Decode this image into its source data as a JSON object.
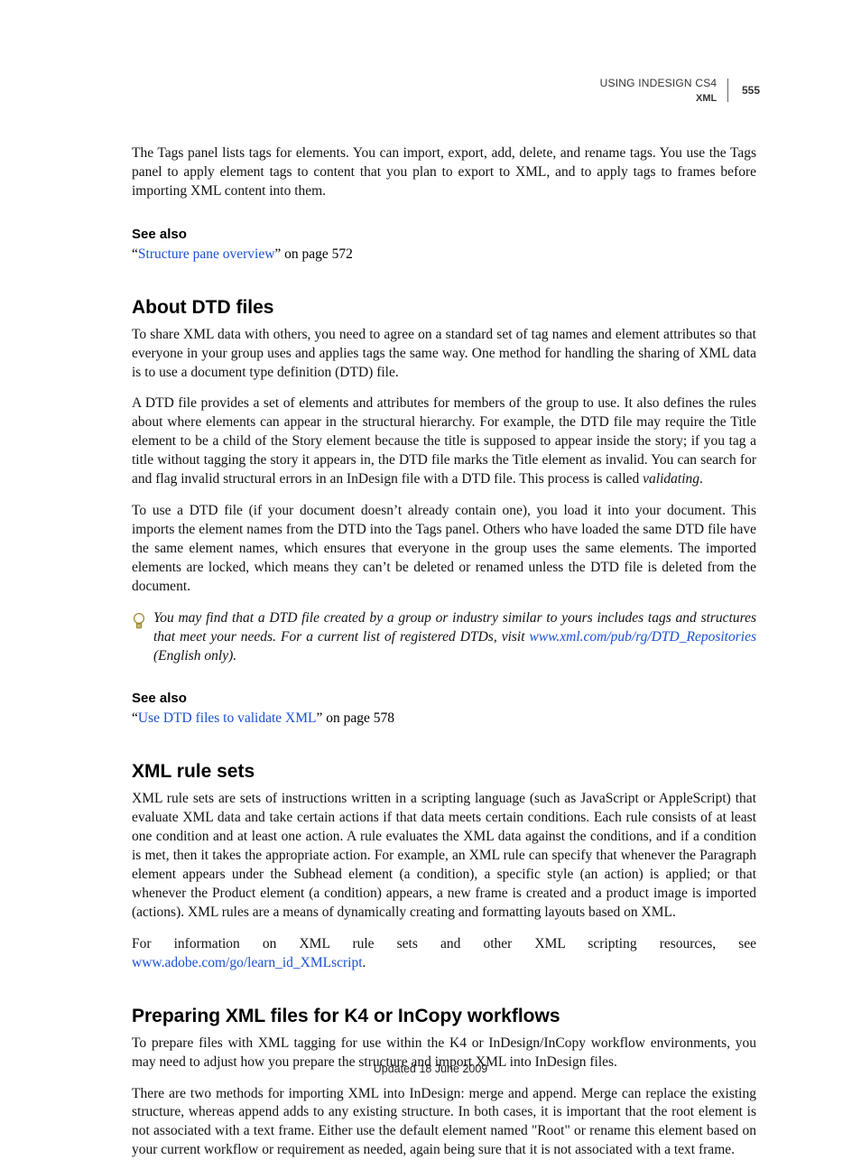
{
  "header": {
    "doc_title": "USING INDESIGN CS4",
    "section": "XML",
    "page_number": "555"
  },
  "intro_paragraph": "The Tags panel lists tags for elements. You can import, export, add, delete, and rename tags. You use the Tags panel to apply element tags to content that you plan to export to XML, and to apply tags to frames before importing XML content into them.",
  "see_also_label": "See also",
  "xref1": {
    "open_quote": "“",
    "link_text": "Structure pane overview",
    "tail": "” on page 572"
  },
  "sections": {
    "about_dtd": {
      "title": "About DTD files",
      "p1": "To share XML data with others, you need to agree on a standard set of tag names and element attributes so that everyone in your group uses and applies tags the same way. One method for handling the sharing of XML data is to use a document type definition (DTD) file.",
      "p2_a": "A DTD file provides a set of elements and attributes for members of the group to use. It also defines the rules about where elements can appear in the structural hierarchy. For example, the DTD file may require the Title element to be a child of the Story element because the title is supposed to appear inside the story; if you tag a title without tagging the story it appears in, the DTD file marks the Title element as invalid. You can search for and flag invalid structural errors in an InDesign file with a DTD file. This process is called ",
      "p2_italic": "validating",
      "p2_b": ".",
      "p3": "To use a DTD file (if your document doesn’t already contain one), you load it into your document. This imports the element names from the DTD into the Tags panel. Others who have loaded the same DTD file have the same element names, which ensures that everyone in the group uses the same elements. The imported elements are locked, which means they can’t be deleted or renamed unless the DTD file is deleted from the document.",
      "tip_a": "You may find that a DTD file created by a group or industry similar to yours includes tags and structures that meet your needs. For a current list of registered DTDs, visit ",
      "tip_link": "www.xml.com/pub/rg/DTD_Repositories",
      "tip_b": " (English only)."
    },
    "xref2": {
      "open_quote": "“",
      "link_text": "Use DTD files to validate XML",
      "tail": "” on page 578"
    },
    "xml_rule_sets": {
      "title": "XML rule sets",
      "p1": "XML rule sets are sets of instructions written in a scripting language (such as JavaScript or AppleScript) that evaluate XML data and take certain actions if that data meets certain conditions. Each rule consists of at least one condition and at least one action. A rule evaluates the XML data against the conditions, and if a condition is met, then it takes the appropriate action. For example, an XML rule can specify that whenever the Paragraph element appears under the Subhead element (a condition), a specific style (an action) is applied; or that whenever the Product element (a condition) appears, a new frame is created and a product image is imported (actions). XML rules are a means of dynamically creating and formatting layouts based on XML.",
      "p2_a": "For information on XML rule sets and other XML scripting resources, see ",
      "p2_link": "www.adobe.com/go/learn_id_XMLscript",
      "p2_b": "."
    },
    "preparing": {
      "title": "Preparing XML files for K4 or InCopy workflows",
      "p1": "To prepare files with XML tagging for use within the K4 or InDesign/InCopy workflow environments, you may need to adjust how you prepare the structure and import XML into InDesign files.",
      "p2": "There are two methods for importing XML into InDesign: merge and append. Merge can replace the existing structure, whereas append adds to any existing structure.  In both cases, it is important that the root element is not associated with a text frame. Either use the default element named \"Root\" or rename this element based on your current workflow or requirement as needed, again being sure that it is not associated with a text frame."
    }
  },
  "footer": "Updated 18 June 2009"
}
